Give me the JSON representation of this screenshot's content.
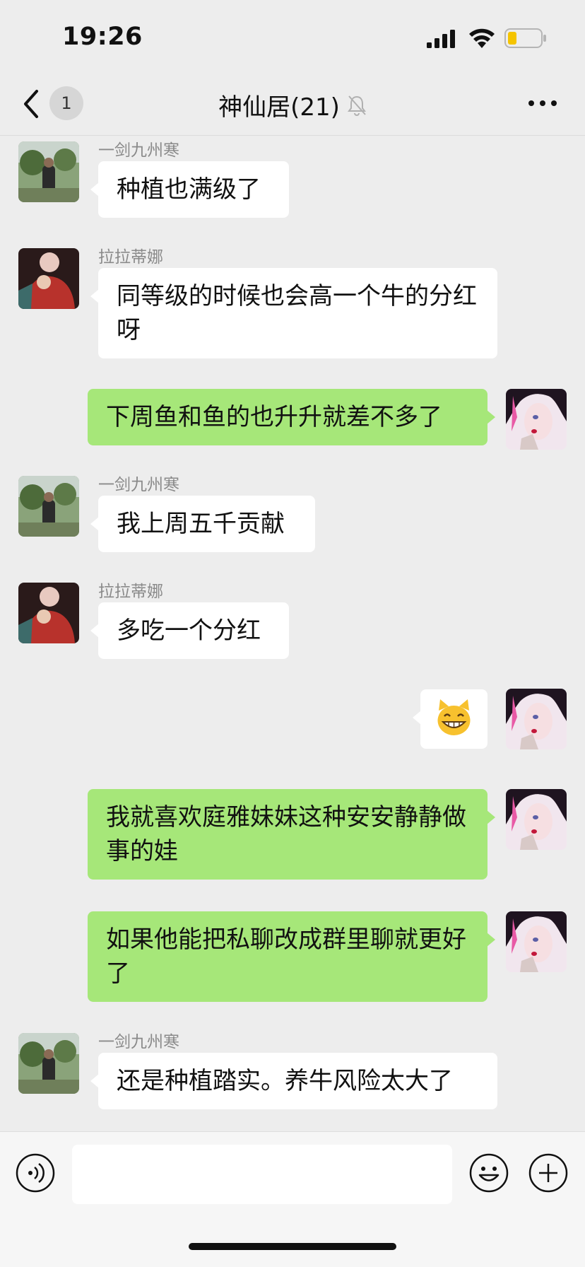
{
  "status_bar": {
    "time": "19:26",
    "battery_color": "#f5c400"
  },
  "nav": {
    "unread_count": "1",
    "title": "神仙居(21)"
  },
  "messages": [
    {
      "sender": "一剑九州寒",
      "text": "种植也满级了"
    },
    {
      "sender": "拉拉蒂娜",
      "text": "同等级的时候也会高一个牛的分红呀"
    },
    {
      "sender": "me",
      "text": "下周鱼和鱼的也升升就差不多了"
    },
    {
      "sender": "一剑九州寒",
      "text": "我上周五千贡献"
    },
    {
      "sender": "拉拉蒂娜",
      "text": "多吃一个分红"
    },
    {
      "sender": "me",
      "sticker": "grinning-cat-emoji"
    },
    {
      "sender": "me",
      "text": "我就喜欢庭雅妹妹这种安安静静做事的娃"
    },
    {
      "sender": "me",
      "text": "如果他能把私聊改成群里聊就更好了"
    },
    {
      "sender": "一剑九州寒",
      "text": "还是种植踏实。养牛风险太大了"
    }
  ],
  "input_bar": {
    "value": "",
    "icons": [
      "voice-icon",
      "emoji-icon",
      "plus-icon"
    ]
  },
  "colors": {
    "outgoing_bubble": "#a6e779",
    "incoming_bubble": "#ffffff",
    "background": "#ededed"
  }
}
